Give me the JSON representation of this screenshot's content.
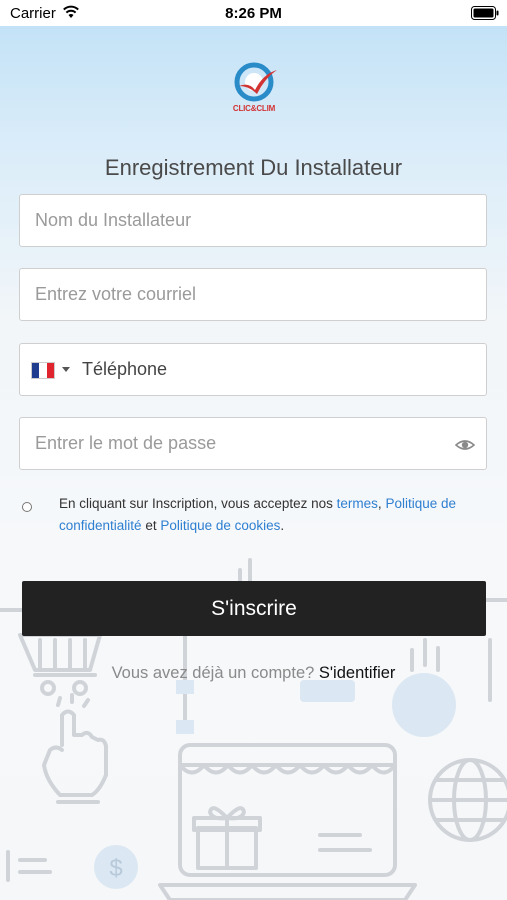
{
  "status_bar": {
    "carrier": "Carrier",
    "time": "8:26 PM"
  },
  "logo": {
    "text": "CLIC&CLIM"
  },
  "page_title": "Enregistrement Du Installateur",
  "form": {
    "name_placeholder": "Nom du Installateur",
    "email_placeholder": "Entrez votre courriel",
    "phone_placeholder": "Téléphone",
    "password_placeholder": "Entrer le mot de passe"
  },
  "consent": {
    "prefix": "En cliquant sur Inscription, vous acceptez nos ",
    "terms": "termes",
    "comma": ", ",
    "privacy": "Politique de confidentialité",
    "and": " et ",
    "cookies": "Politique de cookies",
    "suffix": "."
  },
  "signup_button": "S'inscrire",
  "login": {
    "question": "Vous avez déjà un compte? ",
    "link": "S'identifier"
  },
  "colors": {
    "link": "#2f7fd1",
    "button": "#222222",
    "flag_blue": "#1f3c8f",
    "flag_red": "#e0242e"
  }
}
